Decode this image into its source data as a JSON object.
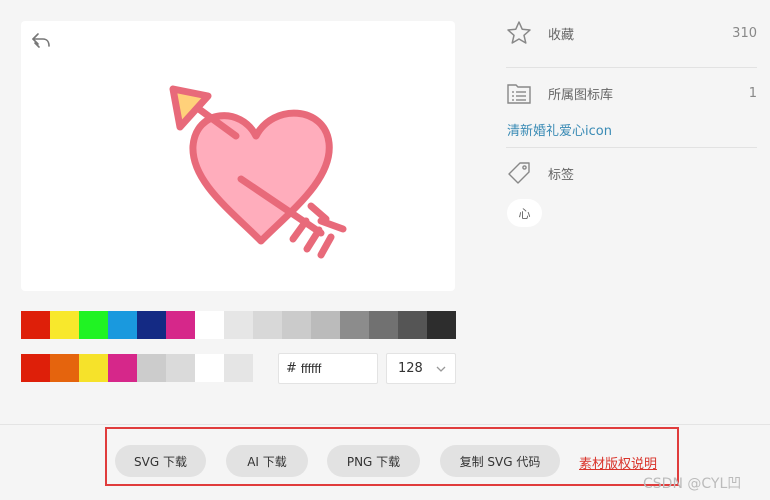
{
  "icons": {
    "back": "reply-arrow-icon",
    "illustration": "heart-with-arrow-icon",
    "favorite": "star-icon",
    "library": "folder-list-icon",
    "tag": "tag-icon",
    "dropdown": "chevron-down-icon"
  },
  "illustration_colors": {
    "fill": "#ffadbc",
    "stroke": "#e86a7a",
    "accent": "#ffd17a"
  },
  "palette": {
    "row1": [
      "#de1f09",
      "#f8e82c",
      "#20f323",
      "#1a99de",
      "#142a84",
      "#d6278a",
      "#ffffff",
      "#e6e6e6",
      "#d8d8d8",
      "#cbcbcb",
      "#bbbbbb",
      "#8c8c8c",
      "#717171",
      "#555555",
      "#2d2d2d"
    ],
    "row2": [
      "#de1f09",
      "#e5640d",
      "#f6e22a",
      "#d6278a",
      "#cccccc",
      "#dadada",
      "#ffffff",
      "#e5e5e5"
    ]
  },
  "color_input": {
    "hash": "#",
    "value": "ffffff"
  },
  "size_select": {
    "value": "128"
  },
  "sidebar": {
    "favorite_label": "收藏",
    "favorite_count": "310",
    "library_label": "所属图标库",
    "library_count": "1",
    "library_link": "清新婚礼爱心icon",
    "tags_label": "标签",
    "tags": [
      "心"
    ]
  },
  "footer": {
    "buttons": [
      "SVG 下载",
      "AI 下载",
      "PNG 下载",
      "复制 SVG 代码"
    ],
    "copyright_link": "素材版权说明",
    "watermark": "CSDN @CYL凹"
  }
}
